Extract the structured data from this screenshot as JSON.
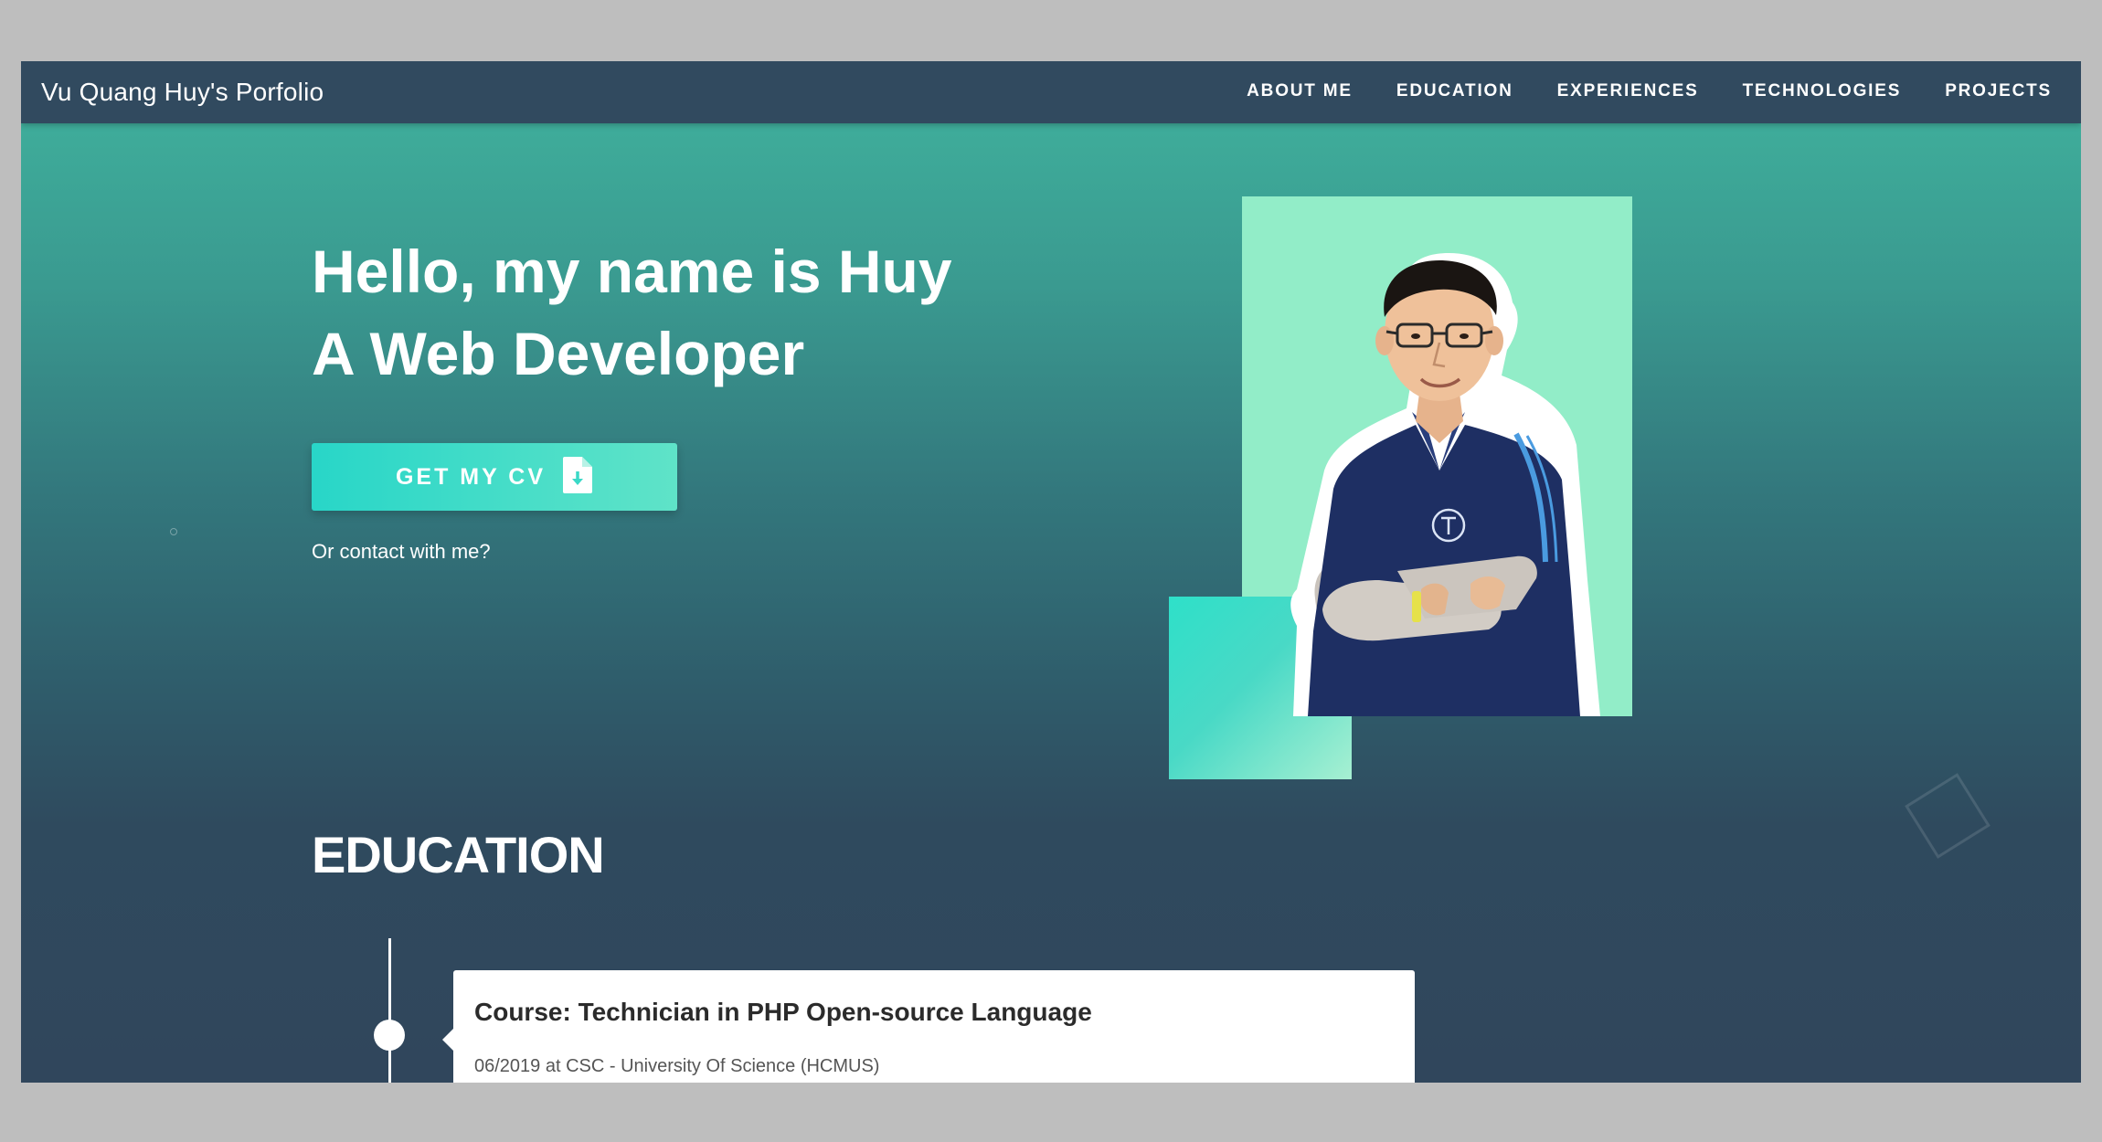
{
  "navbar": {
    "brand": "Vu Quang Huy's Porfolio",
    "links": [
      "ABOUT ME",
      "EDUCATION",
      "EXPERIENCES",
      "TECHNOLOGIES",
      "PROJECTS"
    ]
  },
  "hero": {
    "greeting": "Hello, my name is Huy",
    "role": "A Web Developer",
    "cv_button_label": "GET MY CV",
    "cv_icon": "file-download-icon",
    "contact_link": "Or contact with me?"
  },
  "education": {
    "title": "EDUCATION",
    "items": [
      {
        "title": "Course: Technician in PHP Open-source Language",
        "subtitle": "06/2019 at CSC - University Of Science (HCMUS)"
      }
    ]
  },
  "colors": {
    "navbar_bg": "#314a5f",
    "hero_gradient_top": "#40b39e",
    "hero_gradient_bottom": "#30465c",
    "accent_teal": "#28d6c8",
    "photo_bg": "#92edc8",
    "shirt_navy": "#1e2f63"
  }
}
